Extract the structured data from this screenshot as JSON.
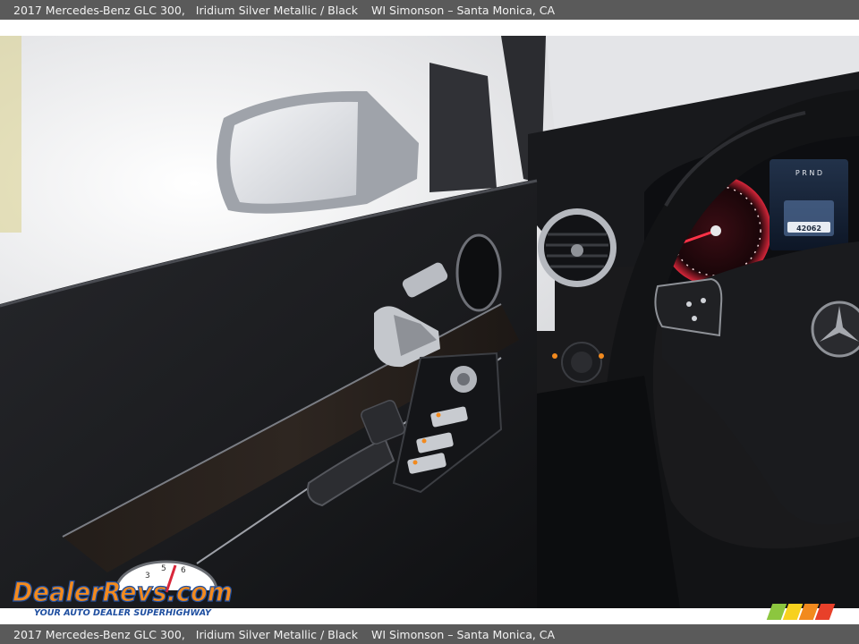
{
  "caption": {
    "vehicle": "2017 Mercedes-Benz GLC 300,",
    "color": "Iridium Silver Metallic / Black",
    "dealer": "WI Simonson – Santa Monica, CA"
  },
  "watermark": {
    "logo_text": "DealerRevs.com",
    "tagline": "YOUR AUTO DEALER SUPERHIGHWAY"
  },
  "cluster": {
    "gear": "P R N D",
    "odometer": "42062"
  },
  "colors": {
    "caption_bar": "#5a5a5a",
    "logo_orange": "#f28a1e",
    "logo_blue": "#1f4fa0",
    "gauge_red": "#d8263a",
    "stripe_colors": [
      "#8cc63f",
      "#f7d11e",
      "#f28a1e",
      "#e8402a"
    ]
  }
}
